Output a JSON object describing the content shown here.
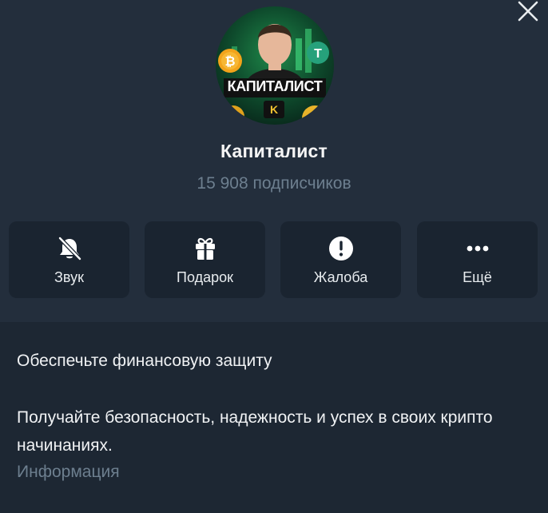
{
  "channel": {
    "name": "Капиталист",
    "subscribers": "15 908 подписчиков",
    "avatar_text": "КАПИТАЛИСТ"
  },
  "actions": [
    {
      "label": "Звук",
      "icon": "bell-muted-icon"
    },
    {
      "label": "Подарок",
      "icon": "gift-icon"
    },
    {
      "label": "Жалоба",
      "icon": "exclamation-icon"
    },
    {
      "label": "Ещё",
      "icon": "more-dots-icon"
    }
  ],
  "description": {
    "line1": "Обеспечьте финансовую защиту",
    "line2": "Получайте безопасность, надежность и успех в своих крипто начинаниях.",
    "label": "Информация"
  },
  "colors": {
    "header_bg": "#232e3c",
    "body_bg": "#1d2733",
    "button_bg": "#1a2430",
    "muted_text": "#6d7f8f"
  }
}
